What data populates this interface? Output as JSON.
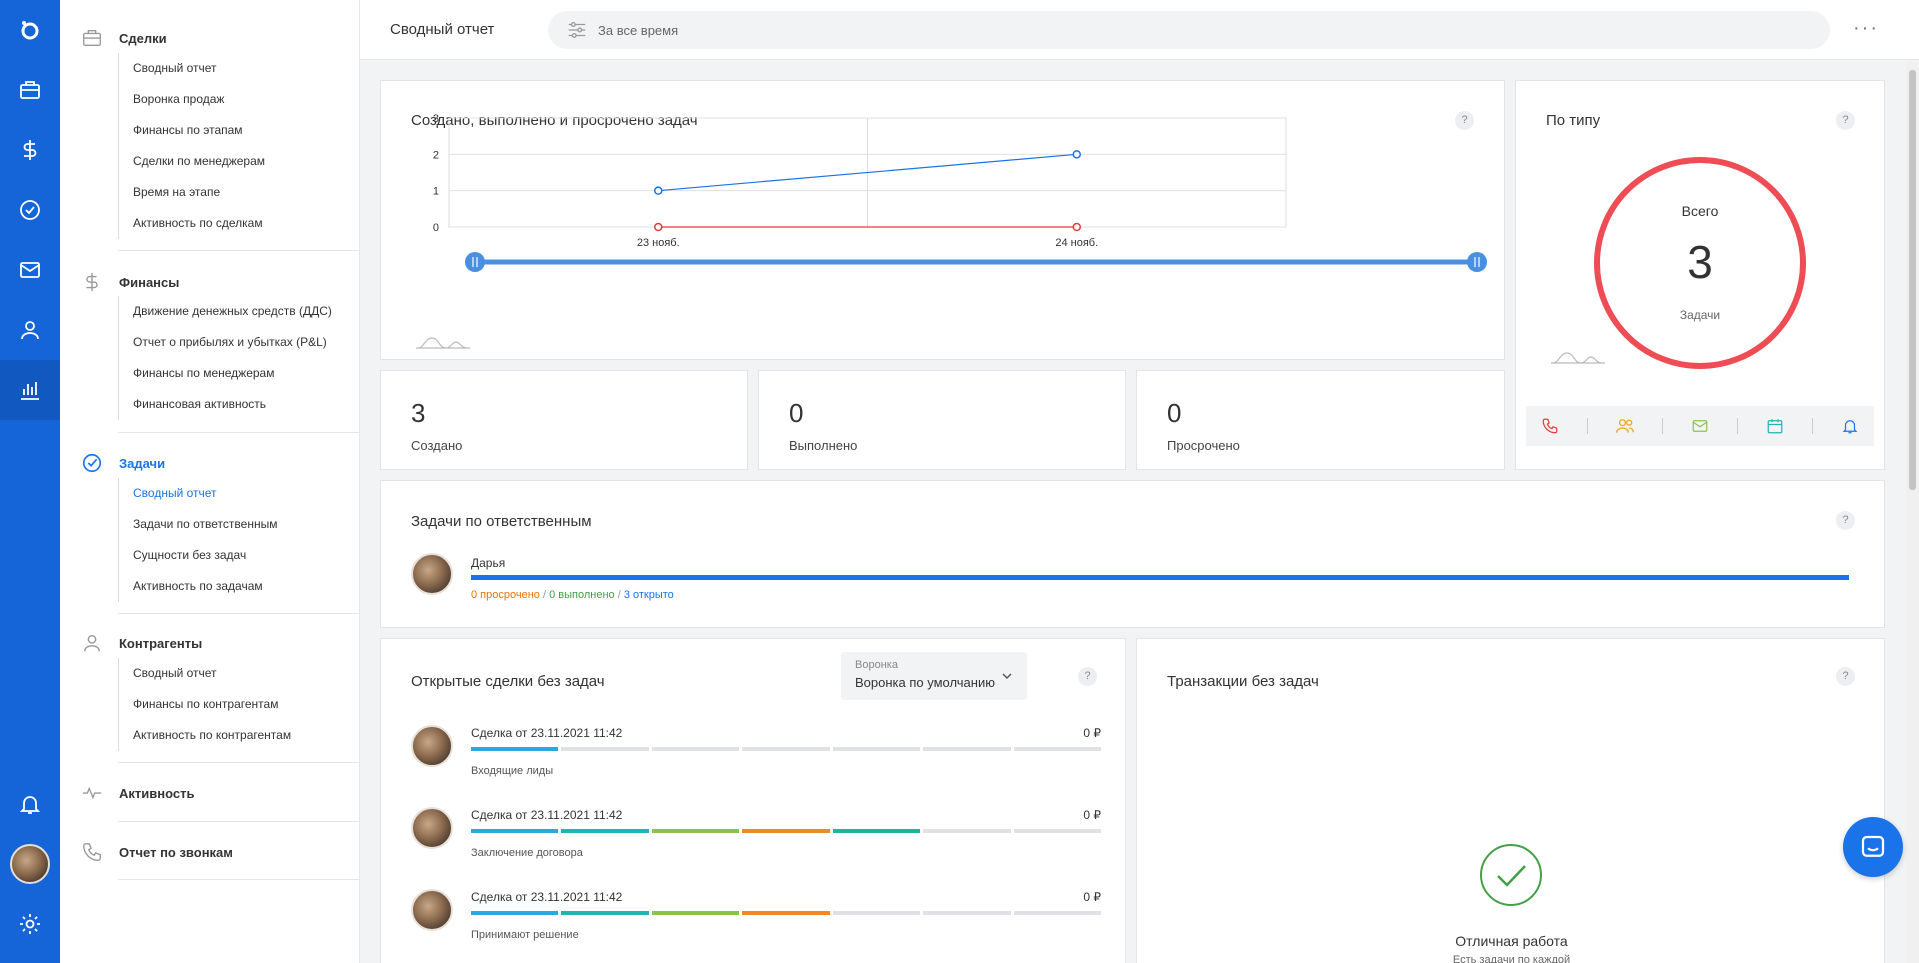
{
  "header": {
    "title": "Сводный отчет",
    "filter_label": "За все время"
  },
  "sidebar": {
    "sections": [
      {
        "title": "Сделки",
        "items": [
          "Сводный отчет",
          "Воронка продаж",
          "Финансы по этапам",
          "Сделки по менеджерам",
          "Время на этапе",
          "Активность по сделкам"
        ]
      },
      {
        "title": "Финансы",
        "items": [
          "Движение денежных средств (ДДС)",
          "Отчет о прибылях и убытках (P&L)",
          "Финансы по менеджерам",
          "Финансовая активность"
        ]
      },
      {
        "title": "Задачи",
        "items": [
          "Сводный отчет",
          "Задачи по ответственным",
          "Сущности без задач",
          "Активность по задачам"
        ]
      },
      {
        "title": "Контрагенты",
        "items": [
          "Сводный отчет",
          "Финансы по контрагентам",
          "Активность по контрагентам"
        ]
      },
      {
        "title": "Активность"
      },
      {
        "title": "Отчет по звонкам"
      }
    ]
  },
  "tasks_chart": {
    "title": "Создано, выполнено и просрочено задач",
    "help": "?"
  },
  "chart_data": {
    "type": "line",
    "categories": [
      "23 нояб.",
      "24 нояб."
    ],
    "series": [
      {
        "values": [
          1,
          2
        ],
        "color": "#1a73e8"
      },
      {
        "values": [
          0,
          0
        ],
        "color": "#e53935"
      }
    ],
    "y_ticks": [
      "0",
      "1",
      "2",
      "3"
    ],
    "ylim": [
      0,
      3
    ],
    "grid": true
  },
  "by_type": {
    "title": "По типу",
    "help": "?",
    "total_label": "Всего",
    "total_value": "3",
    "unit": "Задачи",
    "ring_color": "#ef4d55",
    "icons": [
      "phone-icon",
      "people-icon",
      "mail-icon",
      "calendar-icon",
      "bell-icon"
    ]
  },
  "stats": [
    {
      "value": "3",
      "label": "Создано"
    },
    {
      "value": "0",
      "label": "Выполнено"
    },
    {
      "value": "0",
      "label": "Просрочено"
    }
  ],
  "responsible": {
    "title": "Задачи по ответственным",
    "help": "?",
    "name": "Дарья",
    "overdue": "0 просрочено",
    "done": "0 выполнено",
    "open": "3 открыто",
    "sep": "/",
    "colors": {
      "overdue": "#e8710a",
      "done": "#43a047",
      "open": "#1a73e8"
    }
  },
  "open_deals": {
    "title": "Открытые сделки без задач",
    "help": "?",
    "funnel_label": "Воронка",
    "funnel_value": "Воронка по умолчанию",
    "deals": [
      {
        "name": "Сделка от 23.11.2021 11:42",
        "amount": "0 ₽",
        "stage": "Входящие лиды",
        "filled": 1
      },
      {
        "name": "Сделка от 23.11.2021 11:42",
        "amount": "0 ₽",
        "stage": "Заключение договора",
        "filled": 5
      },
      {
        "name": "Сделка от 23.11.2021 11:42",
        "amount": "0 ₽",
        "stage": "Принимают решение",
        "filled": 4
      }
    ],
    "stage_colors": [
      "#29a9e0",
      "#1fb5b5",
      "#8bc34a",
      "#f08a24",
      "#1fb59a",
      "#dfe1e5",
      "#dfe1e5"
    ]
  },
  "transactions": {
    "title": "Транзакции без задач",
    "help": "?",
    "empty_title": "Отличная работа",
    "empty_sub": "Есть задачи по каждой"
  }
}
